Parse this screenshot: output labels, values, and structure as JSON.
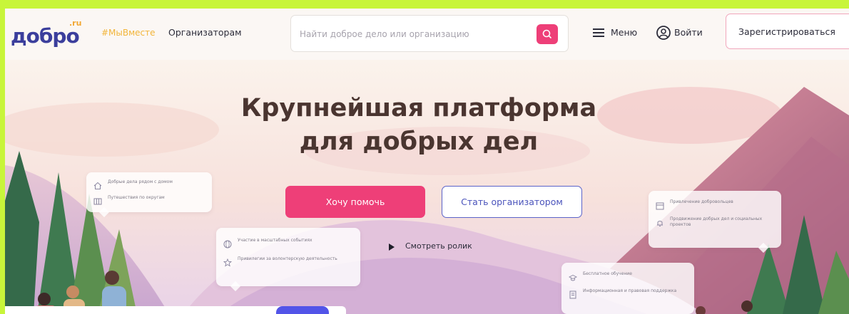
{
  "header": {
    "logo": "добро",
    "logo_suffix": ".ru",
    "tag_link": "#МыВместе",
    "organizers_link": "Организаторам",
    "search": {
      "placeholder": "Найти доброе дело или организацию"
    },
    "menu_label": "Меню",
    "login_label": "Войти",
    "register_label": "Зарегистрироваться"
  },
  "hero": {
    "title_line1": "Крупнейшая платформа",
    "title_line2": "для добрых дел",
    "help_button": "Хочу помочь",
    "organizer_button": "Стать организатором",
    "watch_video": "Смотреть ролик"
  },
  "cards": {
    "left_top": [
      "Добрые дела рядом с домом",
      "Путешествия по округам"
    ],
    "left_bottom": [
      "Участие в масштабных событиях",
      "Привилегии за волонтерскую деятельность"
    ],
    "right_top": [
      "Привлечение добровольцев",
      "Продвижение добрых дел и социальных проектов"
    ],
    "right_bottom": [
      "Бесплатное обучение",
      "Информационная и правовая поддержка"
    ]
  },
  "colors": {
    "accent": "#ee3f78",
    "brand": "#3b3e9c",
    "frame": "#c8f53a"
  }
}
